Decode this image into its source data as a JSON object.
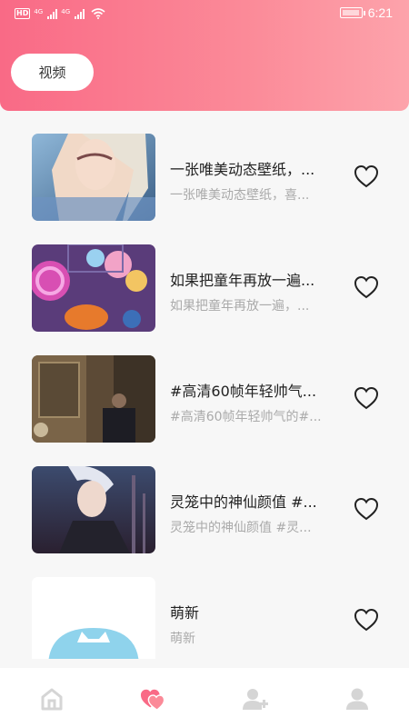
{
  "status_bar": {
    "network_hd": "HD",
    "network_label_1": "4G",
    "network_label_2": "4G",
    "time": "6:21"
  },
  "header": {
    "active_tab": "视频",
    "accent_color": "#f96a86"
  },
  "list": [
    {
      "title": "一张唯美动态壁纸，...",
      "subtitle": "一张唯美动态壁纸，喜...",
      "favorited": false
    },
    {
      "title": "如果把童年再放一遍...",
      "subtitle": "如果把童年再放一遍，...",
      "favorited": false
    },
    {
      "title": "#高清60帧年轻帅气...",
      "subtitle": "#高清60帧年轻帅气的#...",
      "favorited": false
    },
    {
      "title": "灵笼中的神仙颜值 #...",
      "subtitle": "灵笼中的神仙颜值 #灵...",
      "favorited": false
    },
    {
      "title": "萌新",
      "subtitle": "萌新",
      "favorited": false
    }
  ],
  "tabbar": {
    "items": [
      "home-icon",
      "heart-icon",
      "user-add-icon",
      "user-icon"
    ],
    "active_index": 1,
    "active_color": "#f96a86",
    "inactive_color": "#d5d5d5"
  }
}
